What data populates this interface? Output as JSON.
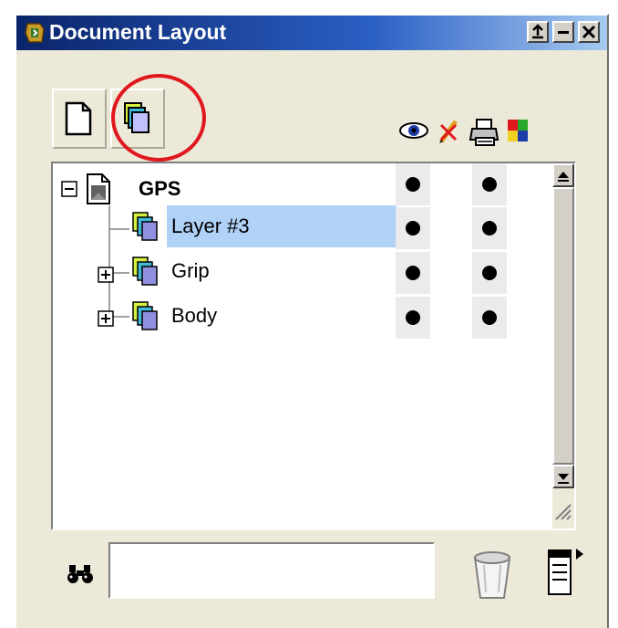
{
  "window": {
    "title": "Document Layout"
  },
  "title_buttons": [
    "pin-icon",
    "minimize-icon",
    "close-icon"
  ],
  "toolbar": {
    "buttons": [
      "new-layer-icon",
      "new-sublayer-icon"
    ],
    "column_icons": [
      "eye-icon",
      "pencil-icon",
      "printer-icon",
      "color-icon"
    ]
  },
  "tree": {
    "rows": [
      {
        "label": "GPS",
        "expanded": true,
        "visible": true,
        "printable": true
      },
      {
        "label": "Layer #3",
        "selected": true,
        "visible": true,
        "printable": true
      },
      {
        "label": "Grip",
        "expanded": false,
        "visible": true,
        "printable": true
      },
      {
        "label": "Body",
        "expanded": false,
        "visible": true,
        "printable": true
      }
    ]
  },
  "search": {
    "value": "",
    "placeholder": ""
  },
  "colors": {
    "highlight": "#e0181e",
    "selection": "#b0d2f7",
    "title_start": "#0a246a",
    "title_end": "#a6caf0"
  }
}
